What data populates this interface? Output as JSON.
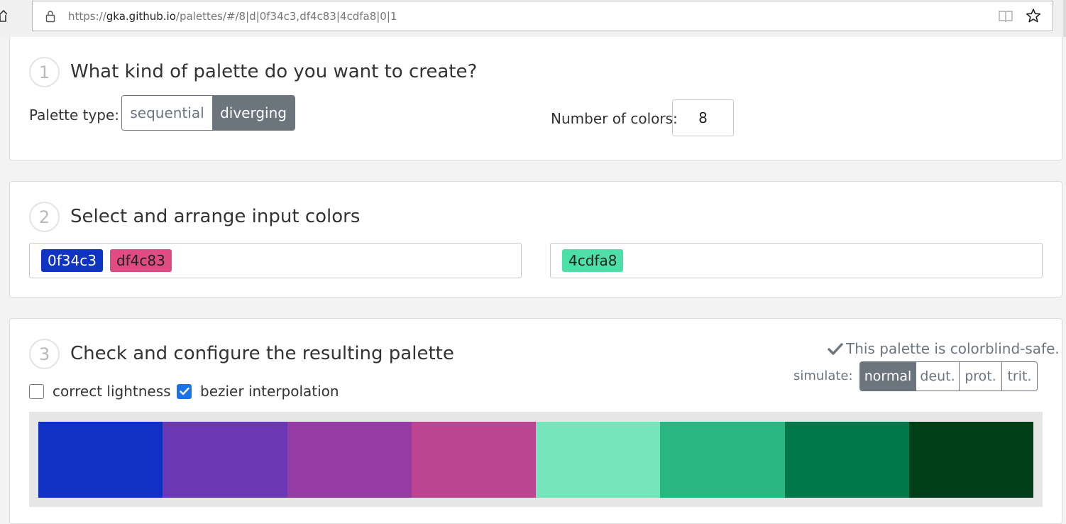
{
  "browser": {
    "url_scheme": "https://",
    "url_host": "gka.github.io",
    "url_path": "/palettes/#/8|d|0f34c3,df4c83|4cdfa8|0|1"
  },
  "step1": {
    "number": "1",
    "title": "What kind of palette do you want to create?",
    "palette_type_label": "Palette type:",
    "options": [
      {
        "label": "sequential",
        "active": false
      },
      {
        "label": "diverging",
        "active": true
      }
    ],
    "num_colors_label": "Number of colors:",
    "num_colors_value": "8"
  },
  "step2": {
    "number": "2",
    "title": "Select and arrange input colors",
    "left_colors": [
      {
        "label": "0f34c3",
        "hex": "#0f34c3"
      },
      {
        "label": "df4c83",
        "hex": "#df4c83"
      }
    ],
    "right_colors": [
      {
        "label": "4cdfa8",
        "hex": "#4cdfa8"
      }
    ]
  },
  "step3": {
    "number": "3",
    "title": "Check and configure the resulting palette",
    "safe_message": "This palette is colorblind-safe.",
    "simulate_label": "simulate:",
    "simulate_options": [
      {
        "label": "normal",
        "active": true
      },
      {
        "label": "deut.",
        "active": false
      },
      {
        "label": "prot.",
        "active": false
      },
      {
        "label": "trit.",
        "active": false
      }
    ],
    "correct_lightness": {
      "label": "correct lightness",
      "checked": false
    },
    "bezier_interpolation": {
      "label": "bezier interpolation",
      "checked": true
    },
    "palette": [
      "#1131c5",
      "#6b38b3",
      "#953ca5",
      "#bb4591",
      "#75e5bb",
      "#28b780",
      "#00784a",
      "#003f18"
    ]
  },
  "colors": {
    "accent_gray": "#6c757d",
    "checkbox_blue": "#1a73e8"
  }
}
